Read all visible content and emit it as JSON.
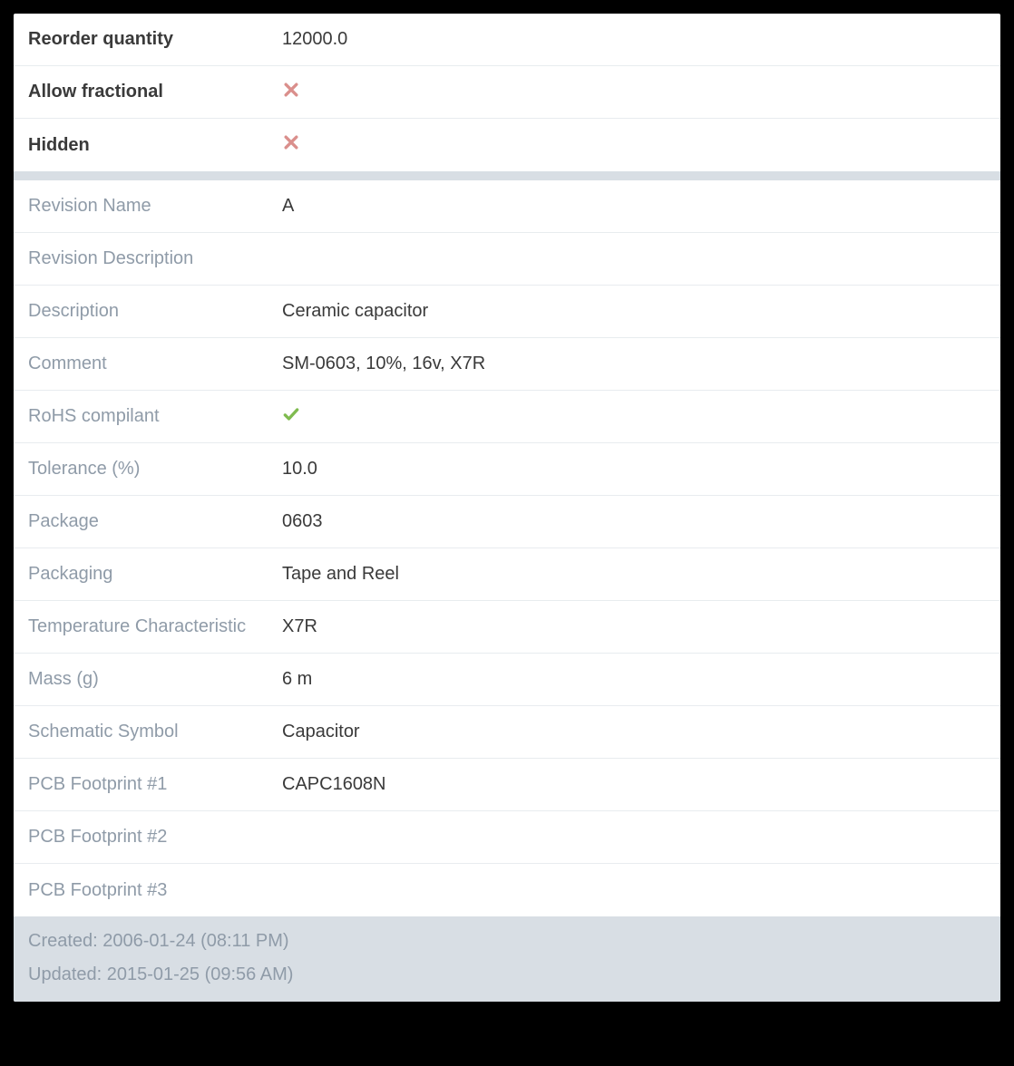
{
  "section1": {
    "reorder_qty": {
      "label": "Reorder quantity",
      "value": "12000.0"
    },
    "allow_fractional": {
      "label": "Allow fractional",
      "value": false
    },
    "hidden": {
      "label": "Hidden",
      "value": false
    }
  },
  "section2": {
    "revision_name": {
      "label": "Revision Name",
      "value": "A"
    },
    "revision_description": {
      "label": "Revision Description",
      "value": ""
    },
    "description": {
      "label": "Description",
      "value": "Ceramic capacitor"
    },
    "comment": {
      "label": "Comment",
      "value": "SM-0603, 10%, 16v, X7R"
    },
    "rohs": {
      "label": "RoHS compilant",
      "value": true
    },
    "tolerance": {
      "label": "Tolerance (%)",
      "value": "10.0"
    },
    "package": {
      "label": "Package",
      "value": "0603"
    },
    "packaging": {
      "label": "Packaging",
      "value": "Tape and Reel"
    },
    "temp_char": {
      "label": "Temperature Characteristic",
      "value": "X7R"
    },
    "mass": {
      "label": "Mass (g)",
      "value": "6 m"
    },
    "schematic_symbol": {
      "label": "Schematic Symbol",
      "value": "Capacitor"
    },
    "pcb_fp1": {
      "label": "PCB Footprint #1",
      "value": "CAPC1608N"
    },
    "pcb_fp2": {
      "label": "PCB Footprint #2",
      "value": ""
    },
    "pcb_fp3": {
      "label": "PCB Footprint #3",
      "value": ""
    }
  },
  "footer": {
    "created_label": "Created: ",
    "created_value": "2006-01-24 (08:11 PM)",
    "updated_label": "Updated: ",
    "updated_value": "2015-01-25 (09:56 AM)"
  }
}
